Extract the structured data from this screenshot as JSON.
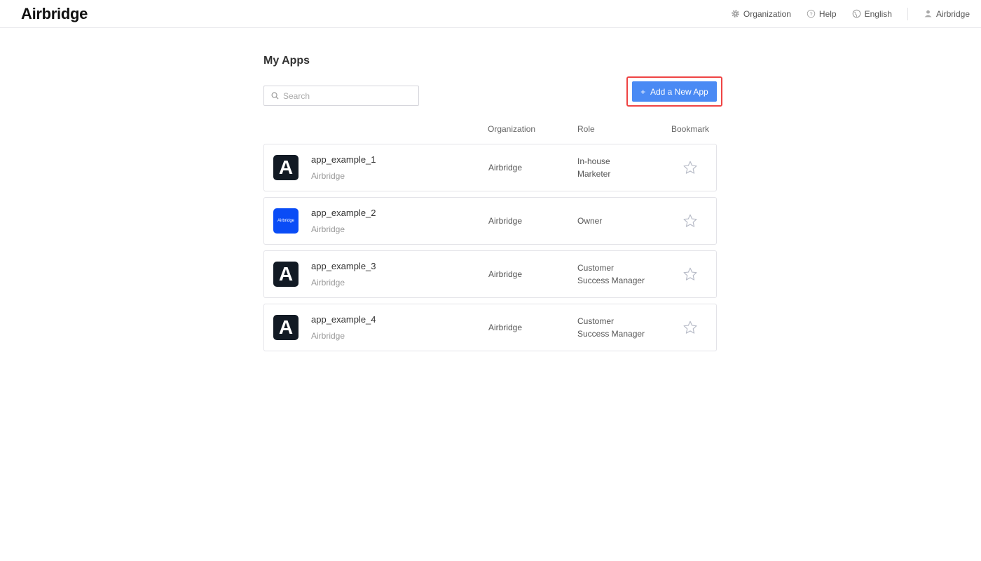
{
  "header": {
    "logo": "Airbridge",
    "nav": {
      "organization": "Organization",
      "help": "Help",
      "language": "English",
      "user": "Airbridge"
    }
  },
  "main": {
    "title": "My Apps",
    "search_placeholder": "Search",
    "add_button": "Add a New App",
    "columns": {
      "organization": "Organization",
      "role": "Role",
      "bookmark": "Bookmark"
    },
    "apps": [
      {
        "name": "app_example_1",
        "org_sub": "Airbridge",
        "organization": "Airbridge",
        "role_line1": "In-house",
        "role_line2": "Marketer",
        "logo_text": "A"
      },
      {
        "name": "app_example_2",
        "org_sub": "Airbridge",
        "organization": "Airbridge",
        "role_line1": "Owner",
        "role_line2": "",
        "logo_text": "Airbridge"
      },
      {
        "name": "app_example_3",
        "org_sub": "Airbridge",
        "organization": "Airbridge",
        "role_line1": "Customer",
        "role_line2": "Success Manager",
        "logo_text": "A"
      },
      {
        "name": "app_example_4",
        "org_sub": "Airbridge",
        "organization": "Airbridge",
        "role_line1": "Customer",
        "role_line2": "Success Manager",
        "logo_text": "A"
      }
    ]
  }
}
